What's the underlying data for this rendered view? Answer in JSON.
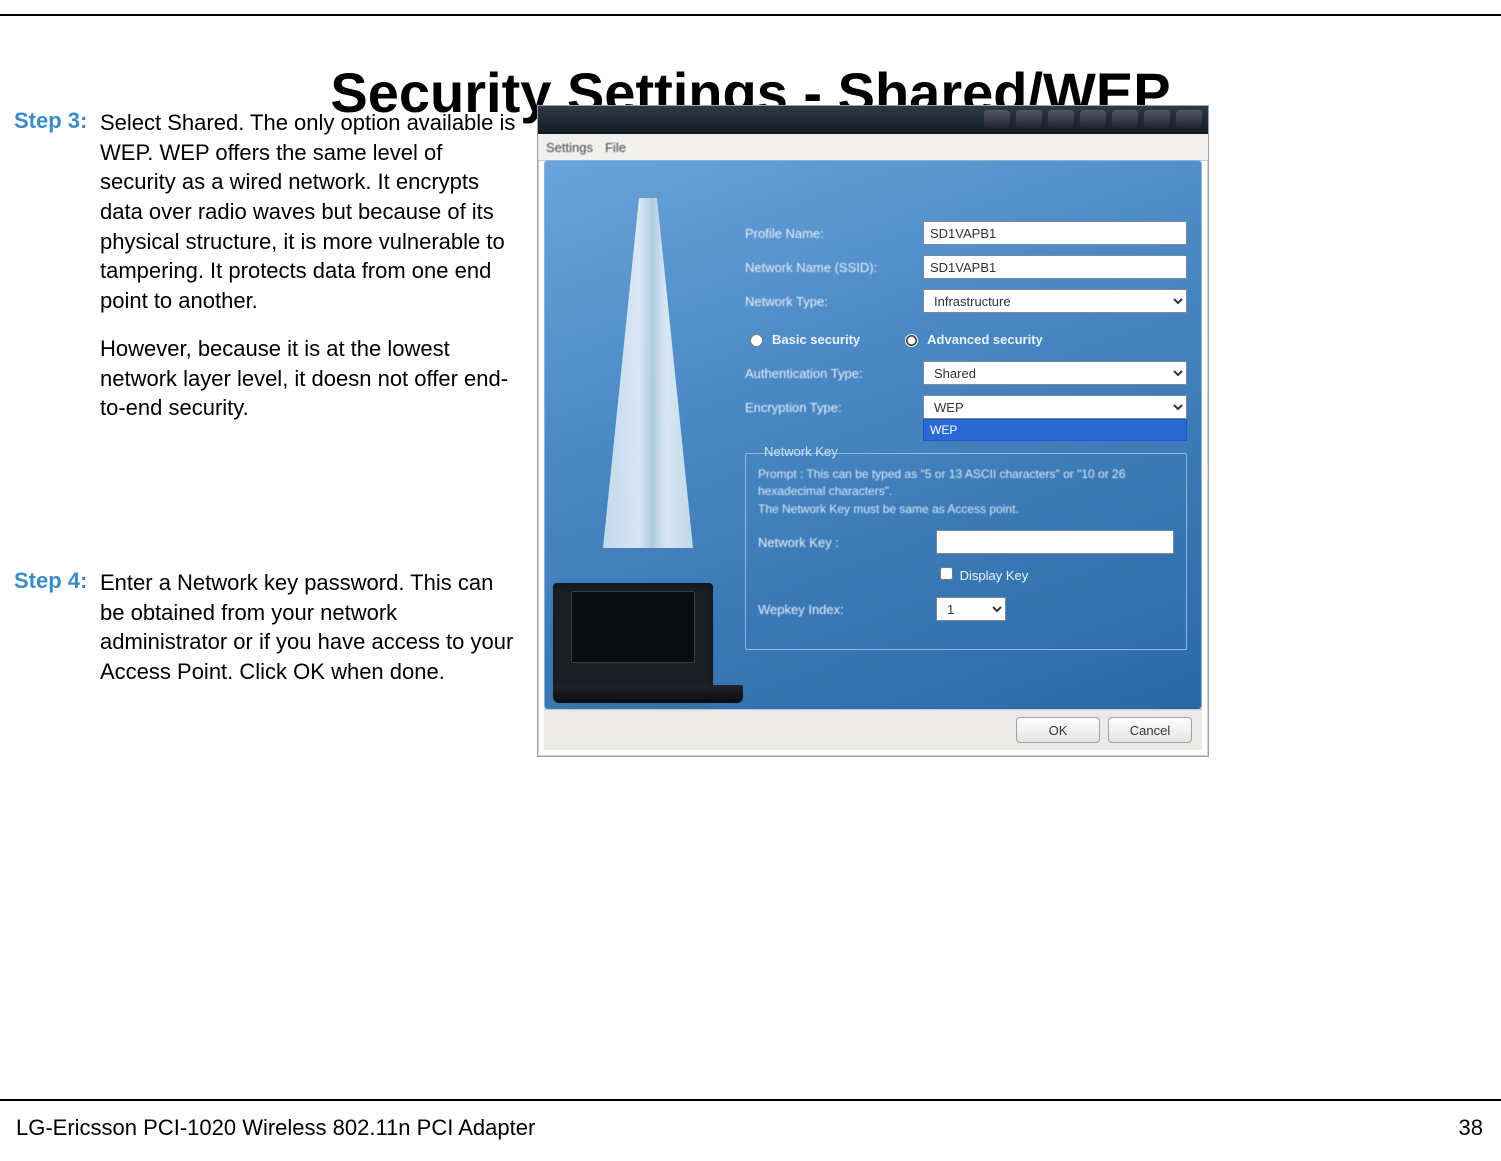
{
  "page": {
    "title": "Security Settings - Shared/WEP",
    "footer_product": "LG-Ericsson PCI-1020 Wireless 802.11n PCI Adapter",
    "page_number": "38"
  },
  "steps": {
    "step3": {
      "label": "Step 3:",
      "p1": "Select Shared. The only option available is WEP. WEP offers the same level of security as a wired network. It encrypts data over radio waves but because of its physical structure, it is more vulnerable to tampering. It protects data from one end point to another.",
      "p2": "However, because it is at the lowest network layer level, it doesn not offer end-to-end security."
    },
    "step4": {
      "label": "Step 4:",
      "p1": "Enter a Network key password. This can be obtained from your network administrator or if you have access to your Access Point. Click OK when done."
    }
  },
  "dialog": {
    "menu": {
      "settings": "Settings",
      "file": "File"
    },
    "labels": {
      "profile_name": "Profile Name:",
      "ssid": "Network Name (SSID):",
      "net_type": "Network Type:",
      "basic_sec": "Basic security",
      "adv_sec": "Advanced security",
      "auth_type": "Authentication Type:",
      "enc_type": "Encryption Type:",
      "fieldset_legend": "Network Key",
      "net_key": "Network Key :",
      "display_key": "Display Key",
      "wep_index": "Wepkey Index:"
    },
    "values": {
      "profile_name": "SD1VAPB1",
      "ssid": "SD1VAPB1",
      "net_type": "Infrastructure",
      "auth_type": "Shared",
      "enc_type": "WEP",
      "enc_dropdown_item": "WEP",
      "net_key": "",
      "wep_index": "1"
    },
    "prompt": {
      "l1": "Prompt : This can be typed as \"5 or 13 ASCII characters\" or \"10 or 26 hexadecimal characters\".",
      "l2": "The Network Key must be same as Access point."
    },
    "buttons": {
      "ok": "OK",
      "cancel": "Cancel"
    }
  }
}
